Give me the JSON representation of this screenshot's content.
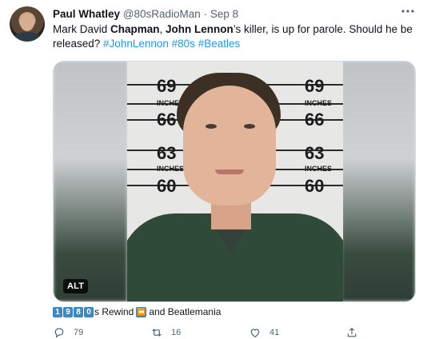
{
  "tweet": {
    "author": {
      "display_name": "Paul Whatley",
      "handle": "@80sRadioMan",
      "separator": "·",
      "time": "Sep 8"
    },
    "text": {
      "part1": "Mark David ",
      "bold1": "Chapman",
      "part2": ", ",
      "bold2": "John Lennon",
      "part3": "’s killer, is up for parole. Should he be released? ",
      "hashtags": [
        "#JohnLennon",
        "#80s",
        "#Beatles"
      ]
    },
    "media": {
      "alt_badge": "ALT",
      "scale_labels": [
        "69",
        "INCHES",
        "66",
        "63",
        "INCHES",
        "60"
      ]
    },
    "card": {
      "digits": [
        "1",
        "9",
        "8",
        "0"
      ],
      "text_before_icon": "s Rewind",
      "text_after_icon": "and Beatlemania",
      "icon": "rewind-icon"
    },
    "actions": {
      "reply_count": "79",
      "retweet_count": "16",
      "like_count": "41",
      "share": ""
    },
    "colors": {
      "accent": "#1d9bf0",
      "muted": "#536471",
      "text": "#0f1419",
      "keycap_blue": "#3b88c3"
    }
  }
}
